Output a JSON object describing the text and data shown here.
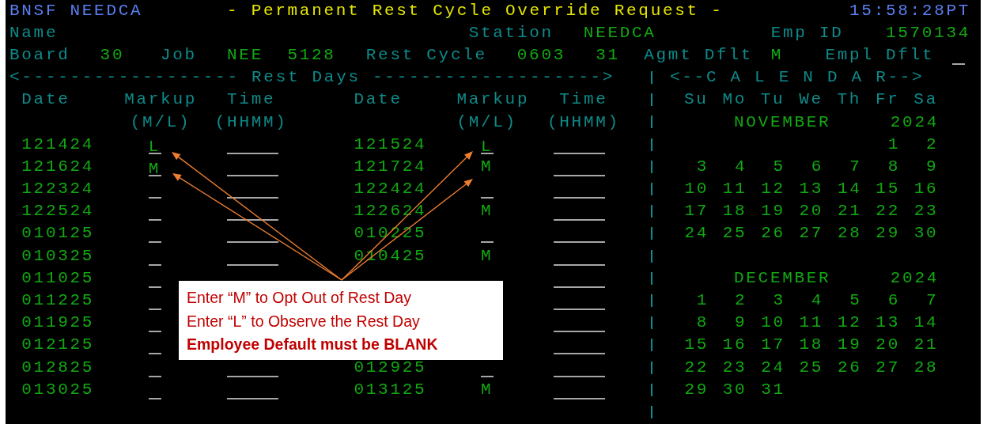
{
  "header": {
    "system": "BNSF NEEDCA",
    "title": "- Permanent Rest Cycle Override Request -",
    "time": "15:58:28PT"
  },
  "info": {
    "name_label": "Name",
    "station_label": "Station",
    "station": "NEEDCA",
    "emp_id_label": "Emp ID",
    "emp_id": "1570134",
    "board_label": "Board",
    "board": "30",
    "job_label": "Job",
    "job_code": "NEE",
    "job_number": "5128",
    "rest_cycle_label": "Rest Cycle",
    "rest_cycle_start": "0603",
    "rest_cycle_days": "31",
    "agmt_dflt_label": "Agmt Dflt",
    "agmt_dflt": "M",
    "empl_dflt_label": "Empl Dflt"
  },
  "rest_days_banner": "<------------------ Rest Days ------------------->",
  "left_table": {
    "columns": [
      {
        "label": "Date"
      },
      {
        "label": "Markup",
        "sublabel": "(M/L)"
      },
      {
        "label": "Time",
        "sublabel": "(HHMM)"
      }
    ],
    "rows": [
      {
        "kind": "full",
        "date": "121424",
        "markup": "L",
        "markup_field": true
      },
      {
        "kind": "full",
        "date": "121624",
        "markup": "M",
        "markup_field": true
      },
      {
        "kind": "full",
        "date": "122324",
        "markup_field": true
      },
      {
        "kind": "full",
        "date": "122524",
        "markup_field": true
      },
      {
        "kind": "full",
        "date": "010125",
        "markup_field": true
      },
      {
        "kind": "full",
        "date": "010325",
        "markup_field": true
      },
      {
        "kind": "no_time",
        "date": "011025",
        "markup_field": true
      },
      {
        "kind": "no_time",
        "date": "011225",
        "markup_field": true
      },
      {
        "kind": "no_time",
        "date": "011925",
        "markup_field": true
      },
      {
        "kind": "no_time",
        "date": "012125",
        "markup_field": true
      },
      {
        "kind": "full",
        "date": "012825",
        "markup_field": true
      },
      {
        "kind": "full",
        "date": "013025",
        "markup_field": true
      }
    ]
  },
  "right_table": {
    "columns": [
      {
        "label": "Date"
      },
      {
        "label": "Markup",
        "sublabel": "(M/L)"
      },
      {
        "label": "Time",
        "sublabel": "(HHMM)"
      }
    ],
    "rows": [
      {
        "kind": "full",
        "date": "121524",
        "markup": "L",
        "markup_field": true
      },
      {
        "kind": "full",
        "date": "121724",
        "markup": "M",
        "markup_field": false
      },
      {
        "kind": "full",
        "date": "122424",
        "markup_field": true
      },
      {
        "kind": "full",
        "date": "122624",
        "markup": "M",
        "markup_field": false
      },
      {
        "kind": "full",
        "date": "010225",
        "markup_field": true
      },
      {
        "kind": "full",
        "date": "010425",
        "markup": "M",
        "markup_field": false
      },
      {
        "kind": "time_only"
      },
      {
        "kind": "time_only"
      },
      {
        "kind": "time_only"
      },
      {
        "kind": "time_only"
      },
      {
        "kind": "full",
        "date": "012925",
        "markup_field": true
      },
      {
        "kind": "full",
        "date": "013125",
        "markup": "M",
        "markup_field": false
      }
    ]
  },
  "calendar": {
    "banner": "<--C A L E N D A R-->",
    "weekdays": [
      "Su",
      "Mo",
      "Tu",
      "We",
      "Th",
      "Fr",
      "Sa"
    ],
    "months": [
      {
        "name": "NOVEMBER",
        "year": "2024",
        "weeks": [
          {
            "kind": "first",
            "days": [
              "1",
              "2"
            ]
          },
          {
            "kind": "full",
            "days": [
              "3",
              "4",
              "5",
              "6",
              "7",
              "8",
              "9"
            ]
          },
          {
            "kind": "full",
            "days": [
              "10",
              "11",
              "12",
              "13",
              "14",
              "15",
              "16"
            ]
          },
          {
            "kind": "full",
            "days": [
              "17",
              "18",
              "19",
              "20",
              "21",
              "22",
              "23"
            ]
          },
          {
            "kind": "full",
            "days": [
              "24",
              "25",
              "26",
              "27",
              "28",
              "29",
              "30"
            ]
          }
        ]
      },
      {
        "name": "DECEMBER",
        "year": "2024",
        "weeks": [
          {
            "kind": "full",
            "days": [
              "1",
              "2",
              "3",
              "4",
              "5",
              "6",
              "7"
            ]
          },
          {
            "kind": "full",
            "days": [
              "8",
              "9",
              "10",
              "11",
              "12",
              "13",
              "14"
            ]
          },
          {
            "kind": "full",
            "days": [
              "15",
              "16",
              "17",
              "18",
              "19",
              "20",
              "21"
            ]
          },
          {
            "kind": "full",
            "days": [
              "22",
              "23",
              "24",
              "25",
              "26",
              "27",
              "28"
            ]
          },
          {
            "kind": "last",
            "days": [
              "29",
              "30",
              "31"
            ]
          }
        ]
      }
    ]
  },
  "callout": {
    "lines": [
      {
        "text": "Enter “M” to Opt Out of Rest Day",
        "bold": false
      },
      {
        "text": "Enter “L” to Observe the Rest Day",
        "bold": false
      },
      {
        "text": "Employee Default must be BLANK",
        "bold": true
      }
    ]
  }
}
